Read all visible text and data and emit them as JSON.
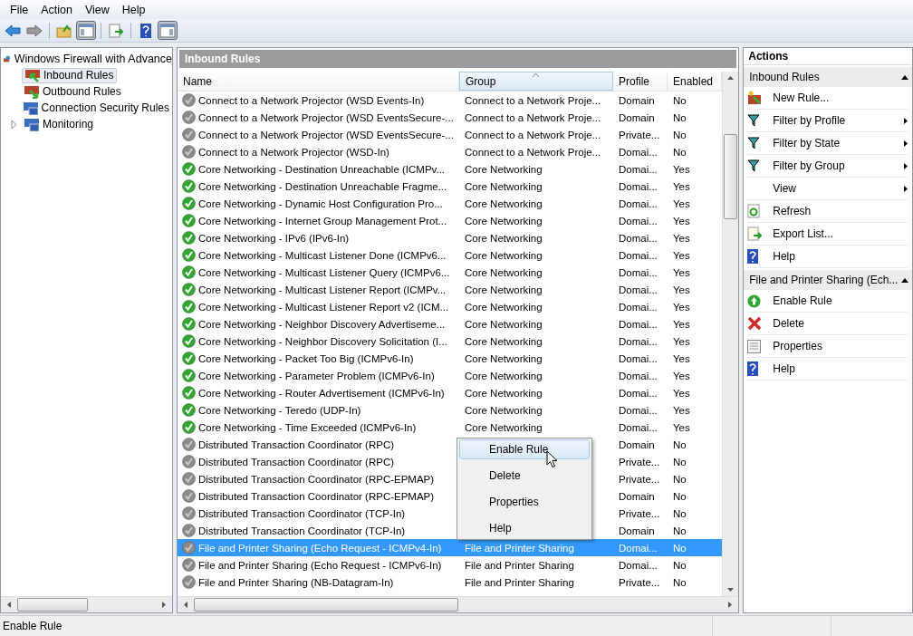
{
  "menu_bar": [
    "File",
    "Action",
    "View",
    "Help"
  ],
  "toolbar": [
    [
      {
        "kind": "back",
        "pressed": false
      },
      {
        "kind": "forward",
        "pressed": false
      }
    ],
    [
      {
        "kind": "up",
        "pressed": false
      },
      {
        "kind": "tree",
        "pressed": true
      }
    ],
    [
      {
        "kind": "export",
        "pressed": false
      }
    ],
    [
      {
        "kind": "help",
        "pressed": false
      },
      {
        "kind": "actionpane",
        "pressed": true
      }
    ]
  ],
  "tree": {
    "label": "Windows Firewall with Advance",
    "children": [
      {
        "label": "Inbound Rules",
        "kind": "inbound",
        "selected": true
      },
      {
        "label": "Outbound Rules",
        "kind": "outbound",
        "selected": false
      },
      {
        "label": "Connection Security Rules",
        "kind": "security",
        "selected": false
      },
      {
        "label": "Monitoring",
        "kind": "monitor",
        "selected": false,
        "expanded": false
      }
    ]
  },
  "rules_pane": {
    "title": "Inbound Rules",
    "columns": [
      {
        "label": "Name",
        "sorted": false
      },
      {
        "label": "Group",
        "sorted": true
      },
      {
        "label": "Profile",
        "sorted": false
      },
      {
        "label": "Enabled",
        "sorted": false
      }
    ],
    "rows": [
      {
        "name": "Connect to a Network Projector (WSD Events-In)",
        "group": "Connect to a Network Proje...",
        "profile": "Domain",
        "enabled": "No",
        "on": false,
        "selected": false
      },
      {
        "name": "Connect to a Network Projector (WSD EventsSecure-...",
        "group": "Connect to a Network Proje...",
        "profile": "Domain",
        "enabled": "No",
        "on": false,
        "selected": false
      },
      {
        "name": "Connect to a Network Projector (WSD EventsSecure-...",
        "group": "Connect to a Network Proje...",
        "profile": "Private...",
        "enabled": "No",
        "on": false,
        "selected": false
      },
      {
        "name": "Connect to a Network Projector (WSD-In)",
        "group": "Connect to a Network Proje...",
        "profile": "Domai...",
        "enabled": "No",
        "on": false,
        "selected": false
      },
      {
        "name": "Core Networking - Destination Unreachable (ICMPv...",
        "group": "Core Networking",
        "profile": "Domai...",
        "enabled": "Yes",
        "on": true,
        "selected": false
      },
      {
        "name": "Core Networking - Destination Unreachable Fragme...",
        "group": "Core Networking",
        "profile": "Domai...",
        "enabled": "Yes",
        "on": true,
        "selected": false
      },
      {
        "name": "Core Networking - Dynamic Host Configuration Pro...",
        "group": "Core Networking",
        "profile": "Domai...",
        "enabled": "Yes",
        "on": true,
        "selected": false
      },
      {
        "name": "Core Networking - Internet Group Management Prot...",
        "group": "Core Networking",
        "profile": "Domai...",
        "enabled": "Yes",
        "on": true,
        "selected": false
      },
      {
        "name": "Core Networking - IPv6 (IPv6-In)",
        "group": "Core Networking",
        "profile": "Domai...",
        "enabled": "Yes",
        "on": true,
        "selected": false
      },
      {
        "name": "Core Networking - Multicast Listener Done (ICMPv6...",
        "group": "Core Networking",
        "profile": "Domai...",
        "enabled": "Yes",
        "on": true,
        "selected": false
      },
      {
        "name": "Core Networking - Multicast Listener Query (ICMPv6...",
        "group": "Core Networking",
        "profile": "Domai...",
        "enabled": "Yes",
        "on": true,
        "selected": false
      },
      {
        "name": "Core Networking - Multicast Listener Report (ICMPv...",
        "group": "Core Networking",
        "profile": "Domai...",
        "enabled": "Yes",
        "on": true,
        "selected": false
      },
      {
        "name": "Core Networking - Multicast Listener Report v2 (ICM...",
        "group": "Core Networking",
        "profile": "Domai...",
        "enabled": "Yes",
        "on": true,
        "selected": false
      },
      {
        "name": "Core Networking - Neighbor Discovery Advertiseme...",
        "group": "Core Networking",
        "profile": "Domai...",
        "enabled": "Yes",
        "on": true,
        "selected": false
      },
      {
        "name": "Core Networking - Neighbor Discovery Solicitation (I...",
        "group": "Core Networking",
        "profile": "Domai...",
        "enabled": "Yes",
        "on": true,
        "selected": false
      },
      {
        "name": "Core Networking - Packet Too Big (ICMPv6-In)",
        "group": "Core Networking",
        "profile": "Domai...",
        "enabled": "Yes",
        "on": true,
        "selected": false
      },
      {
        "name": "Core Networking - Parameter Problem (ICMPv6-In)",
        "group": "Core Networking",
        "profile": "Domai...",
        "enabled": "Yes",
        "on": true,
        "selected": false
      },
      {
        "name": "Core Networking - Router Advertisement (ICMPv6-In)",
        "group": "Core Networking",
        "profile": "Domai...",
        "enabled": "Yes",
        "on": true,
        "selected": false
      },
      {
        "name": "Core Networking - Teredo (UDP-In)",
        "group": "Core Networking",
        "profile": "Domai...",
        "enabled": "Yes",
        "on": true,
        "selected": false
      },
      {
        "name": "Core Networking - Time Exceeded (ICMPv6-In)",
        "group": "Core Networking",
        "profile": "Domai...",
        "enabled": "Yes",
        "on": true,
        "selected": false
      },
      {
        "name": "Distributed Transaction Coordinator (RPC)",
        "profile": "Domain",
        "enabled": "No",
        "on": false,
        "selected": false
      },
      {
        "name": "Distributed Transaction Coordinator (RPC)",
        "profile": "Private...",
        "enabled": "No",
        "on": false,
        "selected": false
      },
      {
        "name": "Distributed Transaction Coordinator (RPC-EPMAP)",
        "profile": "Private...",
        "enabled": "No",
        "on": false,
        "selected": false
      },
      {
        "name": "Distributed Transaction Coordinator (RPC-EPMAP)",
        "profile": "Domain",
        "enabled": "No",
        "on": false,
        "selected": false
      },
      {
        "name": "Distributed Transaction Coordinator (TCP-In)",
        "profile": "Private...",
        "enabled": "No",
        "on": false,
        "selected": false
      },
      {
        "name": "Distributed Transaction Coordinator (TCP-In)",
        "profile": "Domain",
        "enabled": "No",
        "on": false,
        "selected": false
      },
      {
        "name": "File and Printer Sharing (Echo Request - ICMPv4-In)",
        "group": "File and Printer Sharing",
        "profile": "Domai...",
        "enabled": "No",
        "on": false,
        "selected": true
      },
      {
        "name": "File and Printer Sharing (Echo Request - ICMPv6-In)",
        "group": "File and Printer Sharing",
        "profile": "Domai...",
        "enabled": "No",
        "on": false,
        "selected": false
      },
      {
        "name": "File and Printer Sharing (NB-Datagram-In)",
        "group": "File and Printer Sharing",
        "profile": "Private...",
        "enabled": "No",
        "on": false,
        "selected": false
      }
    ]
  },
  "context_menu": [
    {
      "label": "Enable Rule",
      "selected": true
    },
    {
      "label": "Delete",
      "selected": false
    },
    {
      "label": "Properties",
      "selected": false
    },
    {
      "label": "Help",
      "selected": false
    }
  ],
  "actions": {
    "title": "Actions",
    "sections": [
      {
        "heading": "Inbound Rules",
        "expanded": true,
        "items": [
          {
            "label": "New Rule...",
            "kind": "newrule",
            "submenu": false
          },
          {
            "label": "Filter by Profile",
            "kind": "filter",
            "submenu": true
          },
          {
            "label": "Filter by State",
            "kind": "filter",
            "submenu": true
          },
          {
            "label": "Filter by Group",
            "kind": "filter",
            "submenu": true
          },
          {
            "label": "View",
            "kind": "plain",
            "submenu": true
          },
          {
            "label": "Refresh",
            "kind": "refresh",
            "submenu": false
          },
          {
            "label": "Export List...",
            "kind": "export",
            "submenu": false
          },
          {
            "label": "Help",
            "kind": "help",
            "submenu": false
          }
        ]
      },
      {
        "heading": "File and Printer Sharing (Ech...",
        "expanded": true,
        "items": [
          {
            "label": "Enable Rule",
            "kind": "enable",
            "submenu": false
          },
          {
            "label": "Delete",
            "kind": "delete",
            "submenu": false
          },
          {
            "label": "Properties",
            "kind": "properties",
            "submenu": false
          },
          {
            "label": "Help",
            "kind": "help",
            "submenu": false
          }
        ]
      }
    ]
  },
  "status_bar": "Enable Rule"
}
